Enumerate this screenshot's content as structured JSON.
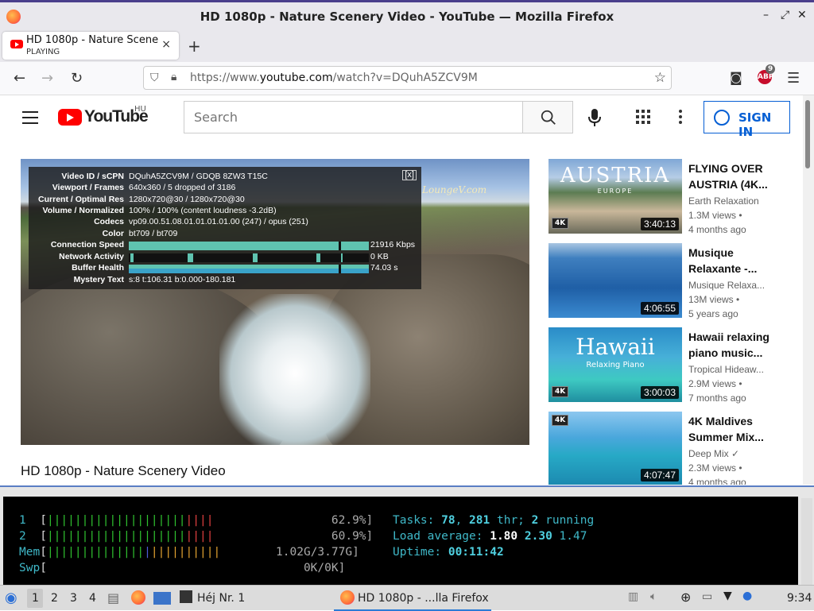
{
  "window": {
    "title": "HD 1080p - Nature Scenery Video - YouTube — Mozilla Firefox",
    "controls": [
      "–",
      "⤢",
      "✕"
    ]
  },
  "tab": {
    "title": "HD 1080p - Nature Scene",
    "status": "PLAYING",
    "close": "×",
    "new_tab": "+"
  },
  "nav": {
    "url_prefix": "https://www.",
    "url_domain": "youtube.com",
    "url_path": "/watch?v=DQuhA5ZCV9M",
    "abp_badge": "9"
  },
  "youtube": {
    "logo_text": "YouTube",
    "region": "HU",
    "search_placeholder": "Search",
    "sign_in": "SIGN IN"
  },
  "stats": {
    "close": "[x]",
    "rows": [
      {
        "key": "Video ID / sCPN",
        "value": "DQuhA5ZCV9M / GDQB 8ZW3 T15C"
      },
      {
        "key": "Viewport / Frames",
        "value": "640x360 / 5 dropped of 3186"
      },
      {
        "key": "Current / Optimal Res",
        "value": "1280x720@30 / 1280x720@30"
      },
      {
        "key": "Volume / Normalized",
        "value": "100% / 100% (content loudness -3.2dB)"
      },
      {
        "key": "Codecs",
        "value": "vp09.00.51.08.01.01.01.01.00 (247) / opus (251)"
      },
      {
        "key": "Color",
        "value": "bt709 / bt709"
      },
      {
        "key": "Connection Speed",
        "value": "21916 Kbps"
      },
      {
        "key": "Network Activity",
        "value": "0 KB"
      },
      {
        "key": "Buffer Health",
        "value": "74.03 s"
      },
      {
        "key": "Mystery Text",
        "value": "s:8 t:106.31 b:0.000-180.181"
      }
    ]
  },
  "video": {
    "watermark": "LoungeV.com",
    "title": "HD 1080p - Nature Scenery Video"
  },
  "recommendations": [
    {
      "thumb_text": "AUSTRIA",
      "thumb_sub": "EUROPE",
      "badge": "4K",
      "duration": "3:40:13",
      "title_l1": "FLYING OVER",
      "title_l2": "AUSTRIA (4K...",
      "channel": "Earth Relaxation",
      "views": "1.3M views •",
      "age": "4 months ago"
    },
    {
      "thumb_text": "",
      "thumb_sub": "",
      "badge": "",
      "duration": "4:06:55",
      "title_l1": "Musique",
      "title_l2": "Relaxante -...",
      "channel": "Musique Relaxa...",
      "views": "13M views •",
      "age": "5 years ago"
    },
    {
      "thumb_text": "Hawaii",
      "thumb_sub": "Relaxing Piano",
      "badge": "4K",
      "duration": "3:00:03",
      "title_l1": "Hawaii relaxing",
      "title_l2": "piano music...",
      "channel": "Tropical Hideaw...",
      "views": "2.9M views •",
      "age": "7 months ago"
    },
    {
      "thumb_text": "",
      "thumb_sub": "",
      "badge": "4K",
      "duration": "4:07:47",
      "title_l1": "4K Maldives",
      "title_l2": "Summer Mix...",
      "channel": "Deep Mix ✓",
      "views": "2.3M views •",
      "age": "4 months ago"
    }
  ],
  "htop": {
    "cpu1": {
      "label": "1",
      "pct": "62.9%]"
    },
    "cpu2": {
      "label": "2",
      "pct": "60.9%]"
    },
    "mem": {
      "label": "Mem",
      "value": "1.02G/3.77G]"
    },
    "swp": {
      "label": "Swp",
      "value": "0K/0K]"
    },
    "tasks_label": "Tasks: ",
    "tasks": "78",
    "thr": "281",
    "thr_label": " thr; ",
    "running": "2",
    "running_label": " running",
    "load_label": "Load average: ",
    "load1": "1.80",
    "load5": "2.30",
    "load15": "1.47",
    "uptime_label": "Uptime: ",
    "uptime": "00:11:42"
  },
  "taskbar": {
    "workspaces": [
      "1",
      "2",
      "3",
      "4"
    ],
    "terminal_task": "Héj Nr. 1",
    "firefox_task": "HD 1080p - ...lla Firefox",
    "clock": "9:34"
  }
}
